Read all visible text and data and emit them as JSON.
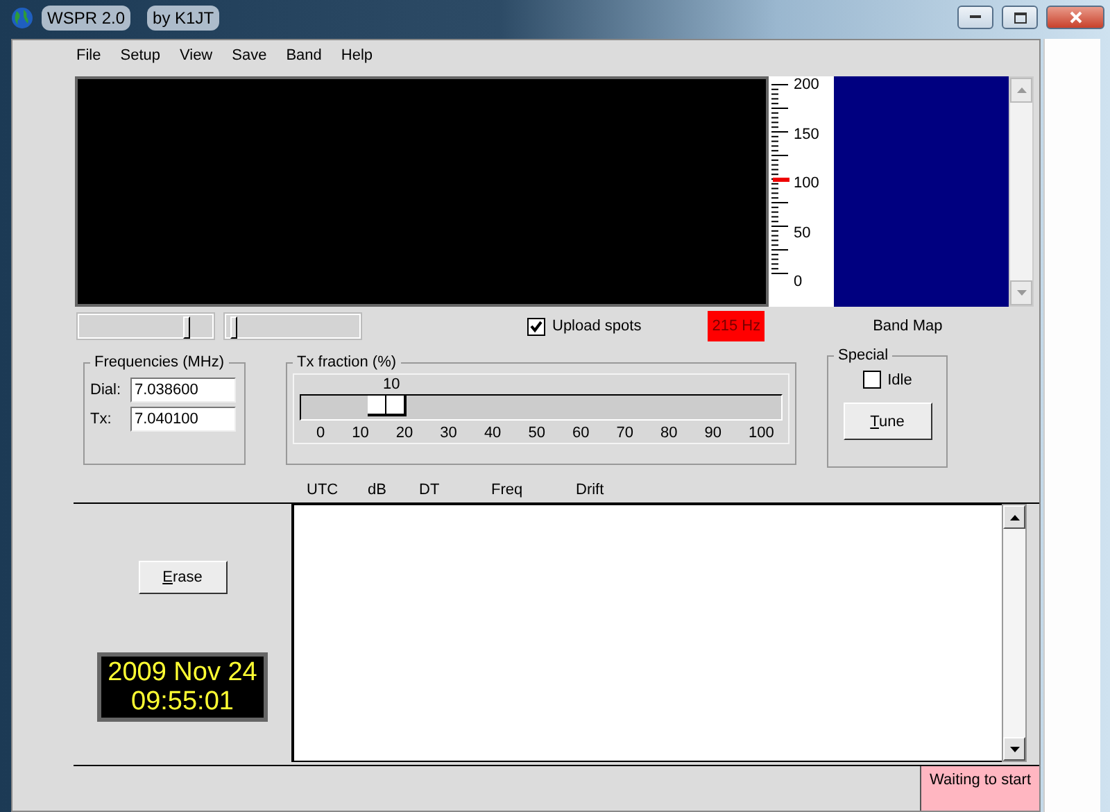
{
  "window": {
    "title": "WSPR 2.0",
    "subtitle": "by K1JT"
  },
  "menu": [
    "File",
    "Setup",
    "View",
    "Save",
    "Band",
    "Help"
  ],
  "scale": {
    "ticks": [
      "200",
      "150",
      "100",
      "50",
      "0"
    ],
    "level": 0.5
  },
  "sliders": [
    {
      "level": 0.82
    },
    {
      "level": 0.03
    }
  ],
  "upload_spots": {
    "label": "Upload spots",
    "checked": true
  },
  "offset": "215 Hz",
  "band_map": {
    "label": "Band Map"
  },
  "frequencies": {
    "title": "Frequencies (MHz)",
    "fields": [
      {
        "label": "Dial:",
        "value": "7.038600"
      },
      {
        "label": "Tx:",
        "value": "7.040100"
      }
    ]
  },
  "tx_fraction": {
    "title": "Tx fraction (%)",
    "reading": "10",
    "level": 0.1,
    "ticks": [
      "0",
      "10",
      "20",
      "30",
      "40",
      "50",
      "60",
      "70",
      "80",
      "90",
      "100"
    ]
  },
  "special": {
    "title": "Special",
    "idle": {
      "label": "Idle",
      "checked": false
    },
    "button": "Tune"
  },
  "columns": [
    "UTC",
    "dB",
    "DT",
    "Freq",
    "Drift"
  ],
  "erase_button": "Erase",
  "clock": {
    "date": "2009 Nov 24",
    "time": "09:55:01"
  },
  "status_bar": {
    "status": "Waiting to start"
  }
}
